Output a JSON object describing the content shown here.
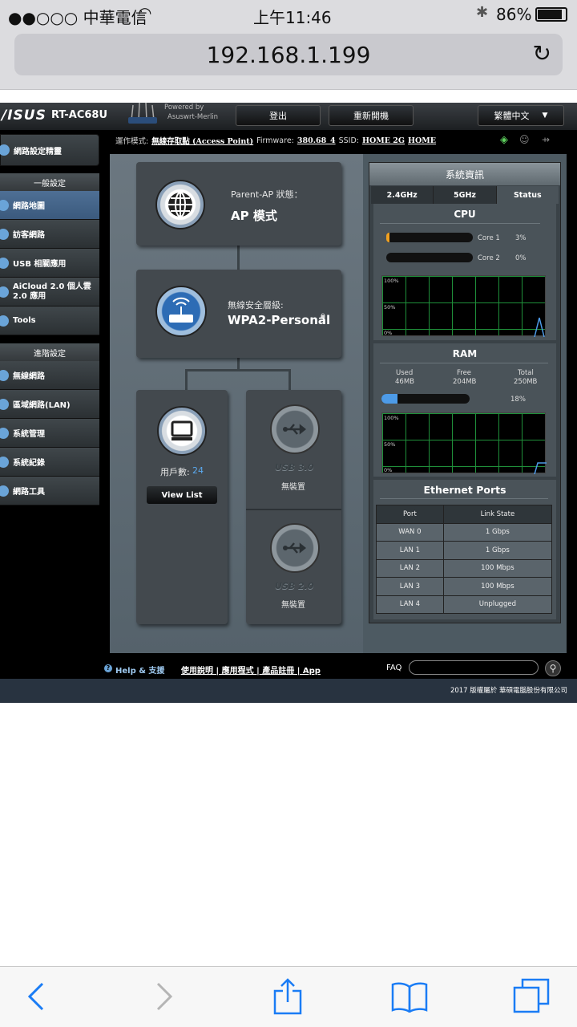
{
  "status_bar": {
    "carrier": "●●○○○ 中華電信",
    "time": "上午11:46",
    "battery": "86%"
  },
  "browser": {
    "url": "192.168.1.199"
  },
  "router": {
    "brand": "/ISUS",
    "model": "RT-AC68U",
    "powered_by": "Powered by",
    "firmware_brand": "Asuswrt-Merlin",
    "logout": "登出",
    "reboot": "重新開機",
    "language": "繁體中文",
    "info": {
      "mode_label": "運作模式:",
      "mode_value": "無線存取點 (Access Point)",
      "firmware_label": "Firmware:",
      "firmware_value": "380.68_4",
      "ssid_label": "SSID:",
      "ssid_1": "HOME 2G",
      "ssid_2": "HOME"
    }
  },
  "sidebar": {
    "quick_setup": "網路設定精靈",
    "general_head": "一般設定",
    "general": [
      "網路地圖",
      "訪客網路",
      "USB 相關應用",
      "AiCloud 2.0 個人雲 2.0 應用",
      "Tools"
    ],
    "advanced_head": "進階設定",
    "advanced": [
      "無線網路",
      "區域網路(LAN)",
      "系統管理",
      "系統紀錄",
      "網路工具"
    ]
  },
  "map": {
    "parent_label": "Parent-AP 狀態：",
    "parent_value": "AP 模式",
    "security_label": "無線安全層級:",
    "security_value": "WPA2-Personal",
    "clients_label": "用戶數:",
    "clients_value": "24",
    "view_list": "View List",
    "usb3_label": "USB 3.0",
    "usb3_status": "無裝置",
    "usb2_label": "USB 2.0",
    "usb2_status": "無裝置"
  },
  "sysinfo": {
    "title": "系統資訊",
    "tabs": [
      "2.4GHz",
      "5GHz",
      "Status"
    ],
    "cpu_title": "CPU",
    "cores": [
      {
        "name": "Core 1",
        "value": "3%",
        "fraction": 0.03
      },
      {
        "name": "Core 2",
        "value": "0%",
        "fraction": 0.0
      }
    ],
    "graph_ticks": [
      "100%",
      "50%",
      "0%"
    ],
    "ram_title": "RAM",
    "ram": {
      "used_label": "Used",
      "used": "46MB",
      "free_label": "Free",
      "free": "204MB",
      "total_label": "Total",
      "total": "250MB",
      "percent": "18%",
      "fraction": 0.18
    },
    "eth_title": "Ethernet Ports",
    "eth_headers": [
      "Port",
      "Link State"
    ],
    "eth_rows": [
      [
        "WAN 0",
        "1 Gbps"
      ],
      [
        "LAN 1",
        "1 Gbps"
      ],
      [
        "LAN 2",
        "100 Mbps"
      ],
      [
        "LAN 3",
        "100 Mbps"
      ],
      [
        "LAN 4",
        "Unplugged"
      ]
    ]
  },
  "footer": {
    "help": "Help & 支援",
    "links": "使用說明 | 應用程式 | 產品註冊 | App",
    "faq": "FAQ",
    "copyright": "2017 版權屬於 華碩電腦股份有限公司"
  },
  "colors": {
    "accent": "#4d9be8",
    "cpu_bar": "#f0a020"
  }
}
